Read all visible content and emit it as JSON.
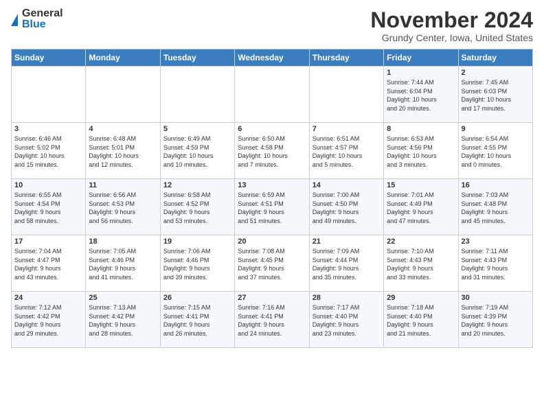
{
  "logo": {
    "general": "General",
    "blue": "Blue"
  },
  "title": "November 2024",
  "location": "Grundy Center, Iowa, United States",
  "days_of_week": [
    "Sunday",
    "Monday",
    "Tuesday",
    "Wednesday",
    "Thursday",
    "Friday",
    "Saturday"
  ],
  "weeks": [
    {
      "days": [
        {
          "date": "",
          "info": ""
        },
        {
          "date": "",
          "info": ""
        },
        {
          "date": "",
          "info": ""
        },
        {
          "date": "",
          "info": ""
        },
        {
          "date": "",
          "info": ""
        },
        {
          "date": "1",
          "info": "Sunrise: 7:44 AM\nSunset: 6:04 PM\nDaylight: 10 hours\nand 20 minutes."
        },
        {
          "date": "2",
          "info": "Sunrise: 7:45 AM\nSunset: 6:03 PM\nDaylight: 10 hours\nand 17 minutes."
        }
      ]
    },
    {
      "days": [
        {
          "date": "3",
          "info": "Sunrise: 6:46 AM\nSunset: 5:02 PM\nDaylight: 10 hours\nand 15 minutes."
        },
        {
          "date": "4",
          "info": "Sunrise: 6:48 AM\nSunset: 5:01 PM\nDaylight: 10 hours\nand 12 minutes."
        },
        {
          "date": "5",
          "info": "Sunrise: 6:49 AM\nSunset: 4:59 PM\nDaylight: 10 hours\nand 10 minutes."
        },
        {
          "date": "6",
          "info": "Sunrise: 6:50 AM\nSunset: 4:58 PM\nDaylight: 10 hours\nand 7 minutes."
        },
        {
          "date": "7",
          "info": "Sunrise: 6:51 AM\nSunset: 4:57 PM\nDaylight: 10 hours\nand 5 minutes."
        },
        {
          "date": "8",
          "info": "Sunrise: 6:53 AM\nSunset: 4:56 PM\nDaylight: 10 hours\nand 3 minutes."
        },
        {
          "date": "9",
          "info": "Sunrise: 6:54 AM\nSunset: 4:55 PM\nDaylight: 10 hours\nand 0 minutes."
        }
      ]
    },
    {
      "days": [
        {
          "date": "10",
          "info": "Sunrise: 6:55 AM\nSunset: 4:54 PM\nDaylight: 9 hours\nand 58 minutes."
        },
        {
          "date": "11",
          "info": "Sunrise: 6:56 AM\nSunset: 4:53 PM\nDaylight: 9 hours\nand 56 minutes."
        },
        {
          "date": "12",
          "info": "Sunrise: 6:58 AM\nSunset: 4:52 PM\nDaylight: 9 hours\nand 53 minutes."
        },
        {
          "date": "13",
          "info": "Sunrise: 6:59 AM\nSunset: 4:51 PM\nDaylight: 9 hours\nand 51 minutes."
        },
        {
          "date": "14",
          "info": "Sunrise: 7:00 AM\nSunset: 4:50 PM\nDaylight: 9 hours\nand 49 minutes."
        },
        {
          "date": "15",
          "info": "Sunrise: 7:01 AM\nSunset: 4:49 PM\nDaylight: 9 hours\nand 47 minutes."
        },
        {
          "date": "16",
          "info": "Sunrise: 7:03 AM\nSunset: 4:48 PM\nDaylight: 9 hours\nand 45 minutes."
        }
      ]
    },
    {
      "days": [
        {
          "date": "17",
          "info": "Sunrise: 7:04 AM\nSunset: 4:47 PM\nDaylight: 9 hours\nand 43 minutes."
        },
        {
          "date": "18",
          "info": "Sunrise: 7:05 AM\nSunset: 4:46 PM\nDaylight: 9 hours\nand 41 minutes."
        },
        {
          "date": "19",
          "info": "Sunrise: 7:06 AM\nSunset: 4:46 PM\nDaylight: 9 hours\nand 39 minutes."
        },
        {
          "date": "20",
          "info": "Sunrise: 7:08 AM\nSunset: 4:45 PM\nDaylight: 9 hours\nand 37 minutes."
        },
        {
          "date": "21",
          "info": "Sunrise: 7:09 AM\nSunset: 4:44 PM\nDaylight: 9 hours\nand 35 minutes."
        },
        {
          "date": "22",
          "info": "Sunrise: 7:10 AM\nSunset: 4:43 PM\nDaylight: 9 hours\nand 33 minutes."
        },
        {
          "date": "23",
          "info": "Sunrise: 7:11 AM\nSunset: 4:43 PM\nDaylight: 9 hours\nand 31 minutes."
        }
      ]
    },
    {
      "days": [
        {
          "date": "24",
          "info": "Sunrise: 7:12 AM\nSunset: 4:42 PM\nDaylight: 9 hours\nand 29 minutes."
        },
        {
          "date": "25",
          "info": "Sunrise: 7:13 AM\nSunset: 4:42 PM\nDaylight: 9 hours\nand 28 minutes."
        },
        {
          "date": "26",
          "info": "Sunrise: 7:15 AM\nSunset: 4:41 PM\nDaylight: 9 hours\nand 26 minutes."
        },
        {
          "date": "27",
          "info": "Sunrise: 7:16 AM\nSunset: 4:41 PM\nDaylight: 9 hours\nand 24 minutes."
        },
        {
          "date": "28",
          "info": "Sunrise: 7:17 AM\nSunset: 4:40 PM\nDaylight: 9 hours\nand 23 minutes."
        },
        {
          "date": "29",
          "info": "Sunrise: 7:18 AM\nSunset: 4:40 PM\nDaylight: 9 hours\nand 21 minutes."
        },
        {
          "date": "30",
          "info": "Sunrise: 7:19 AM\nSunset: 4:39 PM\nDaylight: 9 hours\nand 20 minutes."
        }
      ]
    }
  ]
}
